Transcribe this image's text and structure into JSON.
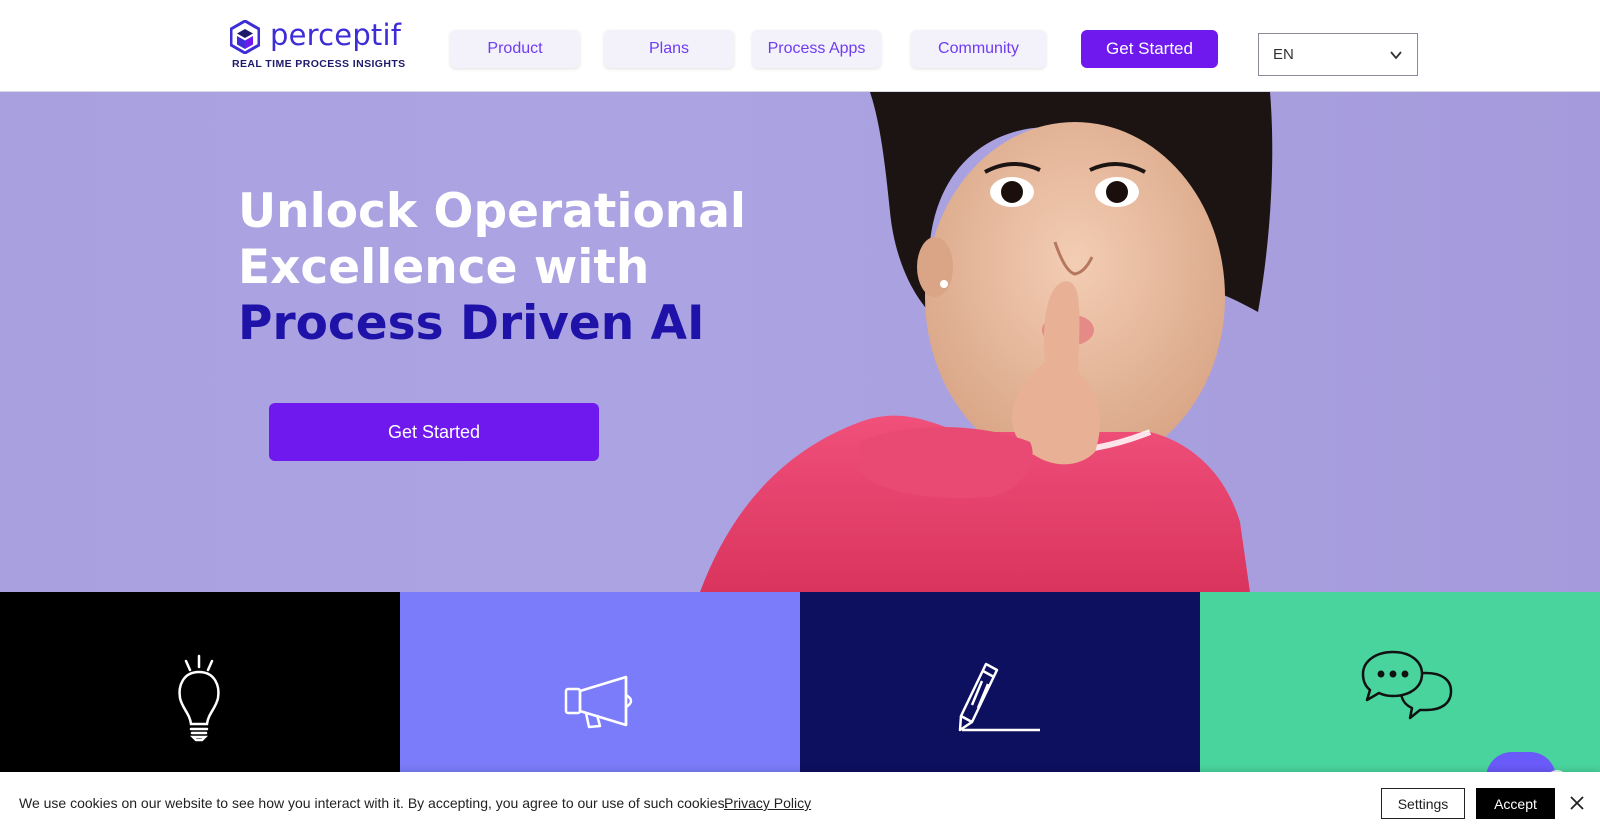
{
  "brand": {
    "name": "perceptif",
    "tagline": "REAL TIME PROCESS INSIGHTS",
    "accent": "#6f19ef",
    "dark_accent": "#1f12a8"
  },
  "nav": {
    "items": [
      {
        "label": "Product"
      },
      {
        "label": "Plans"
      },
      {
        "label": "Process Apps"
      },
      {
        "label": "Community"
      }
    ],
    "cta_label": "Get Started",
    "language": {
      "selected": "EN",
      "icon": "chevron-down-icon"
    }
  },
  "hero": {
    "title_line1": "Unlock Operational",
    "title_line2": "Excellence with",
    "title_line3": "Process Driven AI",
    "cta_label": "Get Started",
    "image": "girl-shushing-photo"
  },
  "tiles": [
    {
      "icon": "lightbulb-icon",
      "color": "#000000"
    },
    {
      "icon": "megaphone-icon",
      "color": "#7b7cf9"
    },
    {
      "icon": "pencil-icon",
      "color": "#0d0f5f"
    },
    {
      "icon": "chat-bubbles-icon",
      "color": "#49d39d"
    }
  ],
  "cookie": {
    "text": "We use cookies on our website to see how you interact with it. By accepting, you agree to our use of such cookies.",
    "link_label": "Privacy Policy",
    "settings_label": "Settings",
    "accept_label": "Accept",
    "close_icon": "close-icon"
  }
}
